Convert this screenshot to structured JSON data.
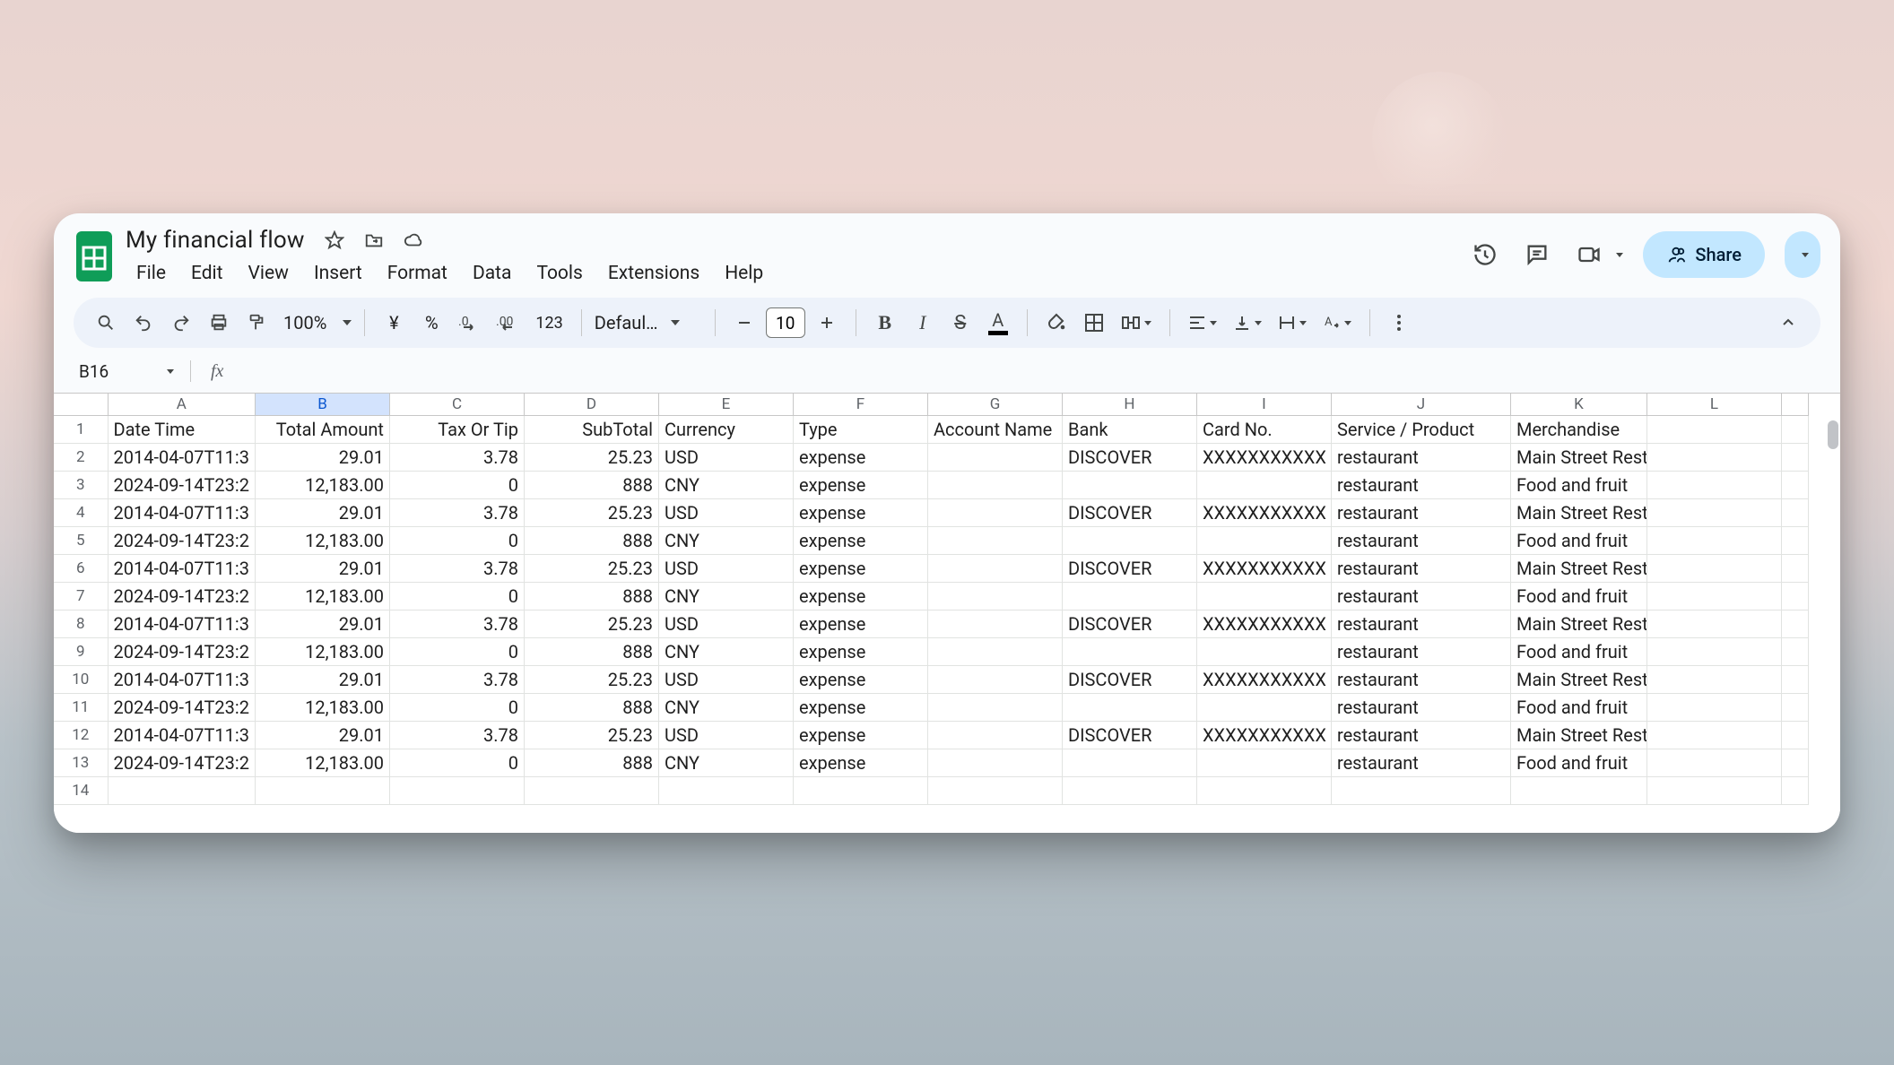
{
  "doc": {
    "title": "My financial flow"
  },
  "menus": [
    "File",
    "Edit",
    "View",
    "Insert",
    "Format",
    "Data",
    "Tools",
    "Extensions",
    "Help"
  ],
  "share": {
    "label": "Share"
  },
  "toolbar": {
    "zoom": "100%",
    "currency_symbol": "¥",
    "percent": "%",
    "format_123": "123",
    "font": "Defaul…",
    "font_size": "10"
  },
  "namebox": "B16",
  "columns": [
    "A",
    "B",
    "C",
    "D",
    "E",
    "F",
    "G",
    "H",
    "I",
    "J",
    "K",
    "L"
  ],
  "selected_column": "B",
  "headers": [
    "Date Time",
    "Total Amount",
    "Tax Or Tip",
    "SubTotal",
    "Currency",
    "Type",
    "Account Name",
    "Bank",
    "Card No.",
    "Service / Product",
    "Merchandise"
  ],
  "rows": [
    {
      "n": 2,
      "date": "2014-04-07T11:3",
      "total": "29.01",
      "tax": "3.78",
      "sub": "25.23",
      "cur": "USD",
      "type": "expense",
      "acct": "",
      "bank": "DISCOVER",
      "card": "XXXXXXXXXXX",
      "svc": "restaurant",
      "merch": "Main Street Restaurant"
    },
    {
      "n": 3,
      "date": "2024-09-14T23:2",
      "total": "12,183.00",
      "tax": "0",
      "sub": "888",
      "cur": "CNY",
      "type": "expense",
      "acct": "",
      "bank": "",
      "card": "",
      "svc": "restaurant",
      "merch": "Food and fruit"
    },
    {
      "n": 4,
      "date": "2014-04-07T11:3",
      "total": "29.01",
      "tax": "3.78",
      "sub": "25.23",
      "cur": "USD",
      "type": "expense",
      "acct": "",
      "bank": "DISCOVER",
      "card": "XXXXXXXXXXX",
      "svc": "restaurant",
      "merch": "Main Street Restaurant"
    },
    {
      "n": 5,
      "date": "2024-09-14T23:2",
      "total": "12,183.00",
      "tax": "0",
      "sub": "888",
      "cur": "CNY",
      "type": "expense",
      "acct": "",
      "bank": "",
      "card": "",
      "svc": "restaurant",
      "merch": "Food and fruit"
    },
    {
      "n": 6,
      "date": "2014-04-07T11:3",
      "total": "29.01",
      "tax": "3.78",
      "sub": "25.23",
      "cur": "USD",
      "type": "expense",
      "acct": "",
      "bank": "DISCOVER",
      "card": "XXXXXXXXXXX",
      "svc": "restaurant",
      "merch": "Main Street Restaurant"
    },
    {
      "n": 7,
      "date": "2024-09-14T23:2",
      "total": "12,183.00",
      "tax": "0",
      "sub": "888",
      "cur": "CNY",
      "type": "expense",
      "acct": "",
      "bank": "",
      "card": "",
      "svc": "restaurant",
      "merch": "Food and fruit"
    },
    {
      "n": 8,
      "date": "2014-04-07T11:3",
      "total": "29.01",
      "tax": "3.78",
      "sub": "25.23",
      "cur": "USD",
      "type": "expense",
      "acct": "",
      "bank": "DISCOVER",
      "card": "XXXXXXXXXXX",
      "svc": "restaurant",
      "merch": "Main Street Restaurant"
    },
    {
      "n": 9,
      "date": "2024-09-14T23:2",
      "total": "12,183.00",
      "tax": "0",
      "sub": "888",
      "cur": "CNY",
      "type": "expense",
      "acct": "",
      "bank": "",
      "card": "",
      "svc": "restaurant",
      "merch": "Food and fruit"
    },
    {
      "n": 10,
      "date": "2014-04-07T11:3",
      "total": "29.01",
      "tax": "3.78",
      "sub": "25.23",
      "cur": "USD",
      "type": "expense",
      "acct": "",
      "bank": "DISCOVER",
      "card": "XXXXXXXXXXX",
      "svc": "restaurant",
      "merch": "Main Street Restaurant"
    },
    {
      "n": 11,
      "date": "2024-09-14T23:2",
      "total": "12,183.00",
      "tax": "0",
      "sub": "888",
      "cur": "CNY",
      "type": "expense",
      "acct": "",
      "bank": "",
      "card": "",
      "svc": "restaurant",
      "merch": "Food and fruit"
    },
    {
      "n": 12,
      "date": "2014-04-07T11:3",
      "total": "29.01",
      "tax": "3.78",
      "sub": "25.23",
      "cur": "USD",
      "type": "expense",
      "acct": "",
      "bank": "DISCOVER",
      "card": "XXXXXXXXXXX",
      "svc": "restaurant",
      "merch": "Main Street Restaurant"
    },
    {
      "n": 13,
      "date": "2024-09-14T23:2",
      "total": "12,183.00",
      "tax": "0",
      "sub": "888",
      "cur": "CNY",
      "type": "expense",
      "acct": "",
      "bank": "",
      "card": "",
      "svc": "restaurant",
      "merch": "Food and fruit"
    }
  ],
  "empty_row": 14
}
